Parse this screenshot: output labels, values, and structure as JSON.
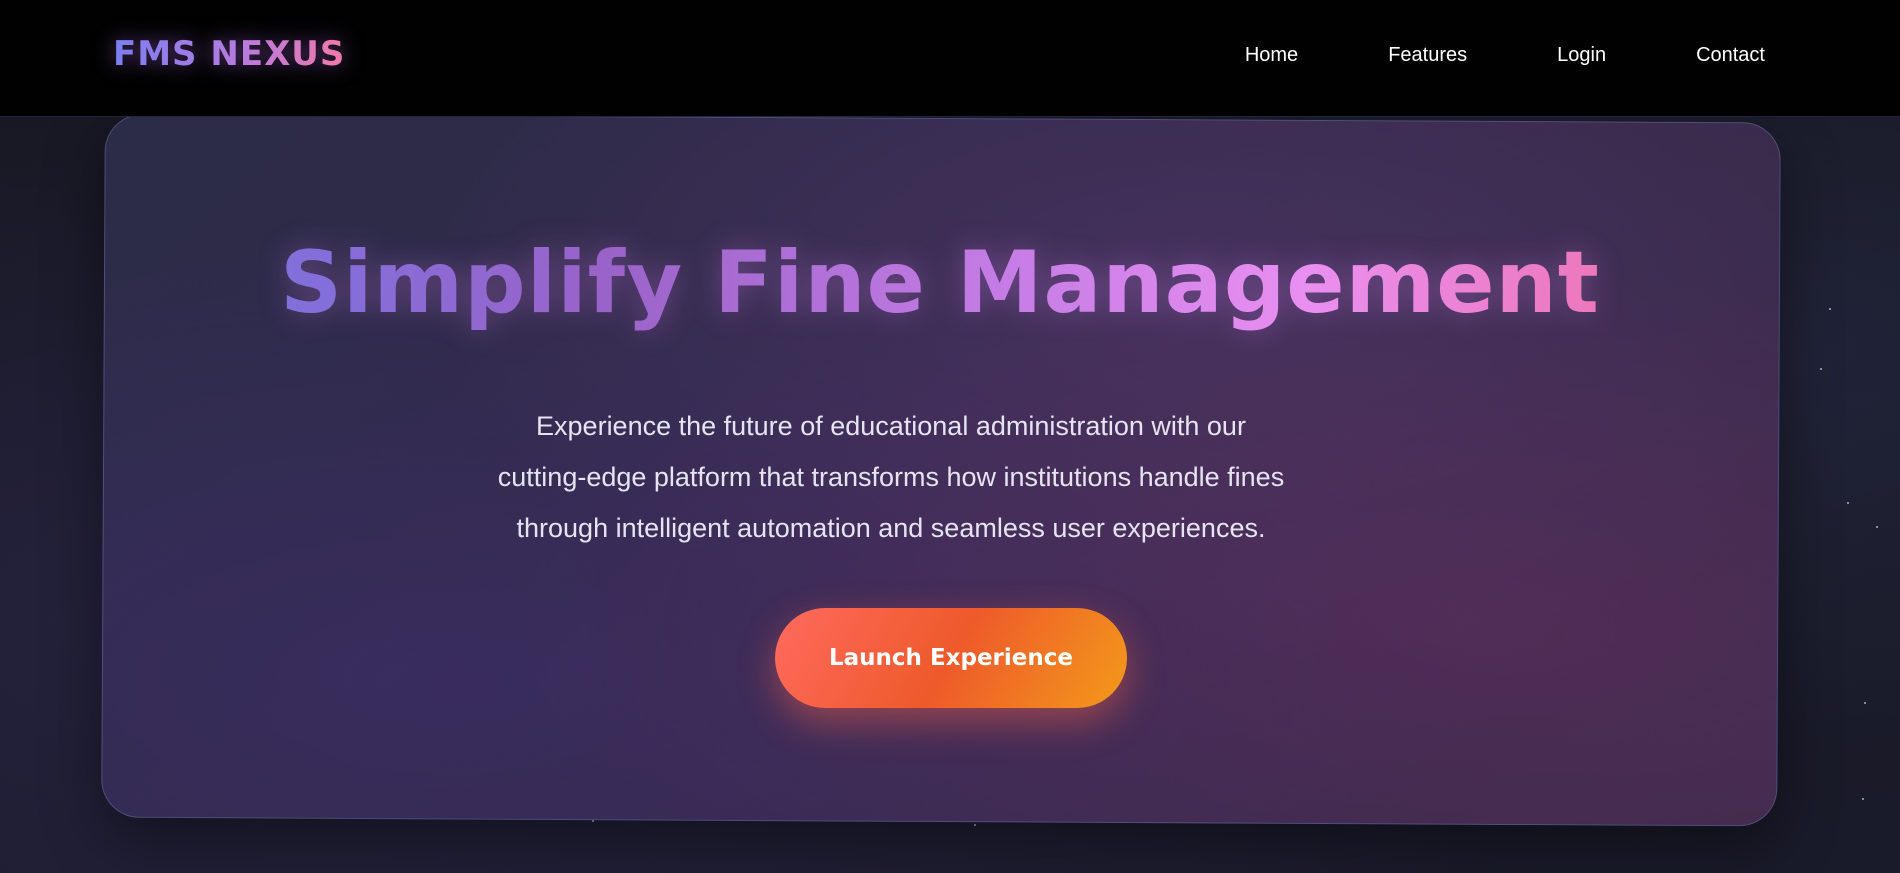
{
  "nav": {
    "brand": "FMS NEXUS",
    "links": [
      {
        "label": "Home"
      },
      {
        "label": "Features"
      },
      {
        "label": "Login"
      },
      {
        "label": "Contact"
      }
    ]
  },
  "hero": {
    "title": "Simplify Fine Management",
    "description_lines": [
      "Experience the future of educational administration with our",
      "cutting-edge platform that transforms how institutions handle fines",
      "through intelligent automation and seamless user experiences."
    ],
    "cta_label": "Launch Experience"
  },
  "colors": {
    "accent_gradient_start": "#7377e6",
    "accent_gradient_mid": "#e98ff0",
    "accent_gradient_end": "#f06a9a",
    "cta_start": "#ff6a5f",
    "cta_end": "#f39a1a"
  }
}
